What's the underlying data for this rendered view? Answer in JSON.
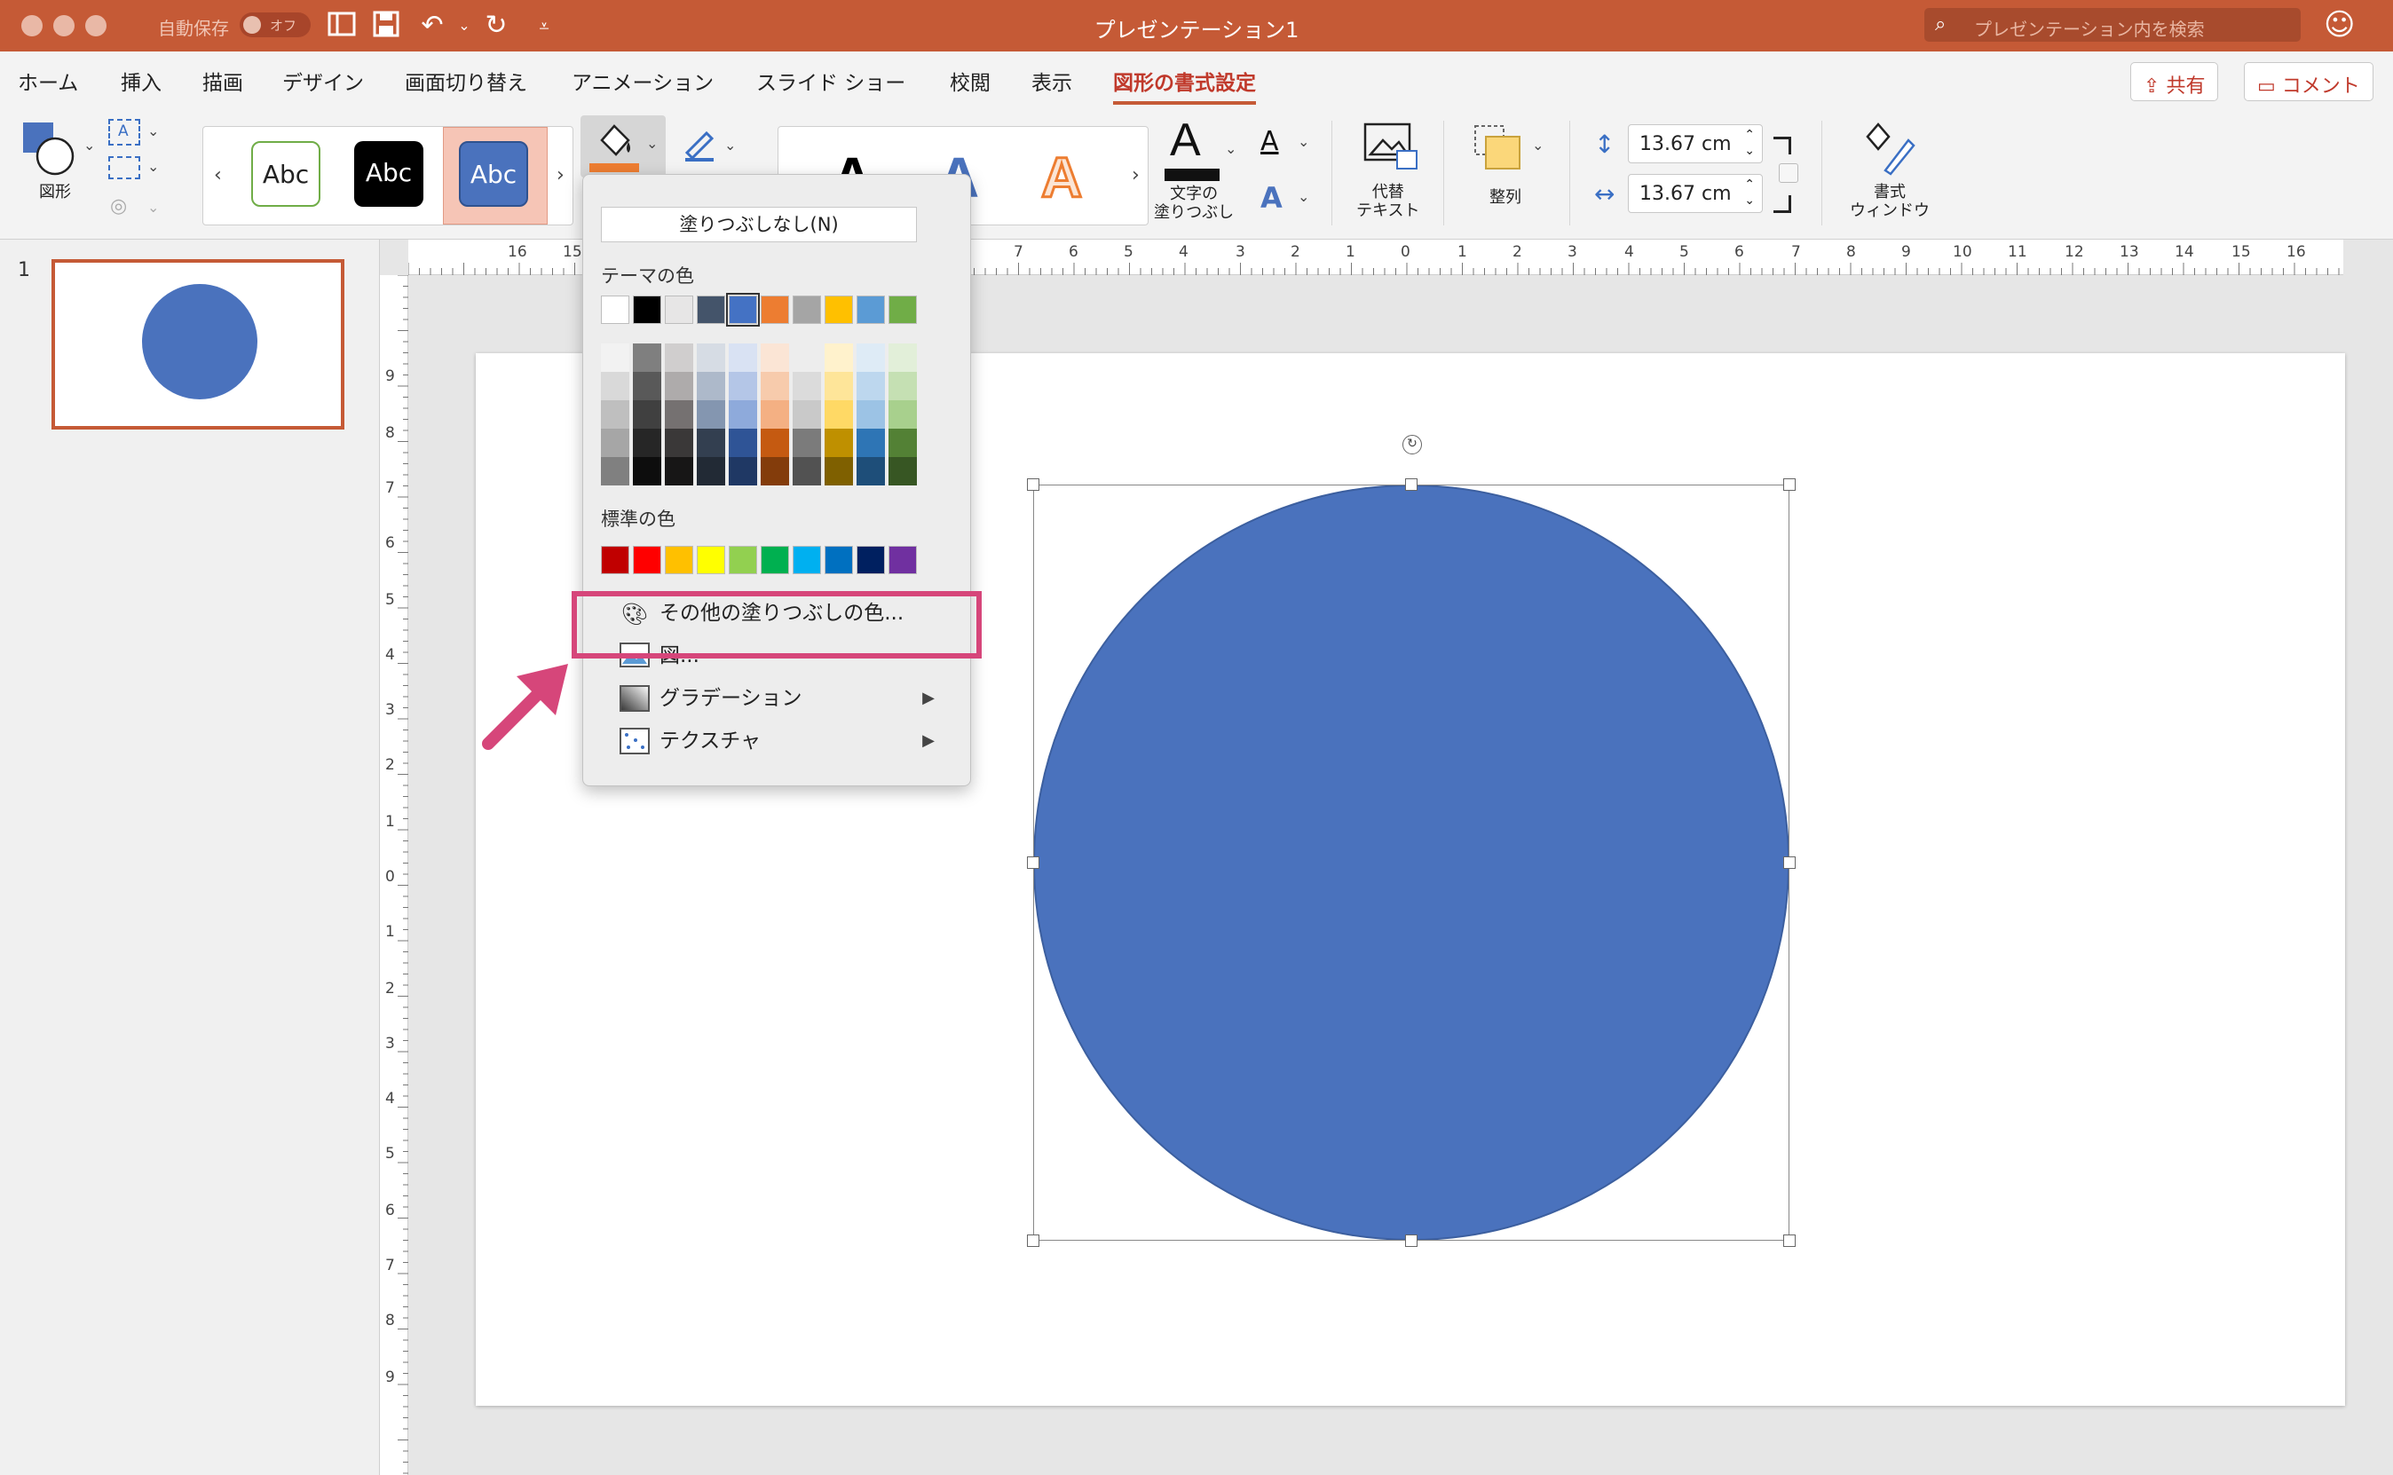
{
  "titlebar": {
    "autosave_label": "自動保存",
    "autosave_state": "オフ",
    "doc_title": "プレゼンテーション1",
    "search_placeholder": "プレゼンテーション内を検索"
  },
  "tabs": [
    {
      "label": "ホーム"
    },
    {
      "label": "挿入"
    },
    {
      "label": "描画"
    },
    {
      "label": "デザイン"
    },
    {
      "label": "画面切り替え"
    },
    {
      "label": "アニメーション"
    },
    {
      "label": "スライド ショー"
    },
    {
      "label": "校閲"
    },
    {
      "label": "表示"
    },
    {
      "label": "図形の書式設定"
    }
  ],
  "share_label": "共有",
  "comment_label": "コメント",
  "ribbon": {
    "shapes_label": "図形",
    "style_samples": [
      "Abc",
      "Abc",
      "Abc"
    ],
    "text_fill_label_1": "文字の",
    "text_fill_label_2": "塗りつぶし",
    "alt_text_label_1": "代替",
    "alt_text_label_2": "テキスト",
    "arrange_label": "整列",
    "height_value": "13.67 cm",
    "width_value": "13.67 cm",
    "format_pane_label_1": "書式",
    "format_pane_label_2": "ウィンドウ",
    "wordart_letter": "A"
  },
  "thumbnail": {
    "number": "1"
  },
  "ruler": {
    "h_ticks": [
      "16",
      "15",
      "7",
      "6",
      "5",
      "4",
      "3",
      "2",
      "1",
      "0",
      "1",
      "2",
      "3",
      "4",
      "5",
      "6",
      "7",
      "8",
      "9",
      "10",
      "11",
      "12",
      "13",
      "14",
      "15",
      "16"
    ],
    "v_ticks": [
      "9",
      "8",
      "7",
      "6",
      "5",
      "4",
      "3",
      "2",
      "1",
      "0",
      "1",
      "2",
      "3",
      "4",
      "5",
      "6",
      "7",
      "8",
      "9"
    ]
  },
  "fill_menu": {
    "no_fill": "塗りつぶしなし(N)",
    "theme_colors_label": "テーマの色",
    "standard_colors_label": "標準の色",
    "more_colors": "その他の塗りつぶしの色...",
    "picture": "図...",
    "gradient": "グラデーション",
    "texture": "テクスチャ",
    "theme_colors": [
      "#ffffff",
      "#000000",
      "#e7e6e6",
      "#44546a",
      "#4472c4",
      "#ed7d31",
      "#a5a5a5",
      "#ffc000",
      "#5b9bd5",
      "#70ad47"
    ],
    "theme_shades": [
      [
        "#f2f2f2",
        "#d9d9d9",
        "#bfbfbf",
        "#a6a6a6",
        "#808080"
      ],
      [
        "#7f7f7f",
        "#595959",
        "#404040",
        "#262626",
        "#0d0d0d"
      ],
      [
        "#d0cece",
        "#aeabab",
        "#757171",
        "#3a3838",
        "#171616"
      ],
      [
        "#d6dce4",
        "#adb9ca",
        "#8496b0",
        "#333f50",
        "#222a35"
      ],
      [
        "#d9e2f3",
        "#b4c6e7",
        "#8eaadb",
        "#2f5496",
        "#1f3864"
      ],
      [
        "#fbe5d5",
        "#f7cbac",
        "#f4b083",
        "#c55a11",
        "#833c0b"
      ],
      [
        "#ededed",
        "#dbdbdb",
        "#c9c9c9",
        "#7b7b7b",
        "#525252"
      ],
      [
        "#fff2cc",
        "#fee599",
        "#ffd965",
        "#bf9000",
        "#7f6000"
      ],
      [
        "#deebf6",
        "#bdd7ee",
        "#9cc3e5",
        "#2e75b5",
        "#1e4e79"
      ],
      [
        "#e2efd9",
        "#c5e0b3",
        "#a8d08d",
        "#538135",
        "#375623"
      ]
    ],
    "standard_colors": [
      "#c00000",
      "#ff0000",
      "#ffc000",
      "#ffff00",
      "#92d050",
      "#00b050",
      "#00b0f0",
      "#0070c0",
      "#002060",
      "#7030a0"
    ]
  },
  "colors": {
    "accent": "#c55a36",
    "shape_fill": "#4a72bd",
    "highlight": "#d6467a"
  }
}
